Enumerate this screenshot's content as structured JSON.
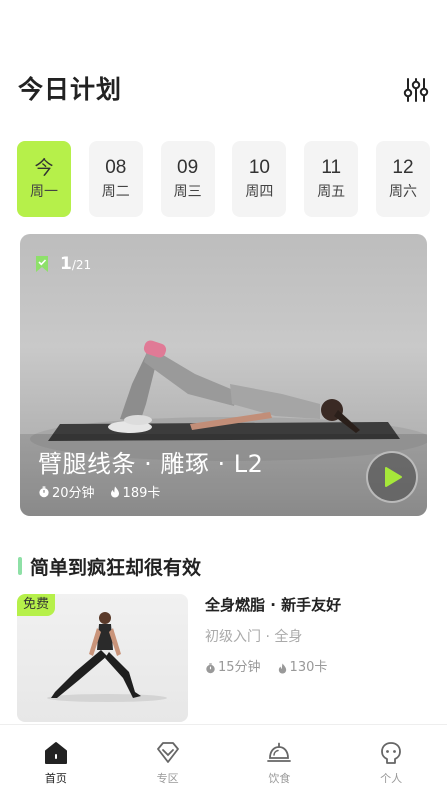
{
  "header": {
    "title": "今日计划",
    "filter_icon": "sliders-icon"
  },
  "days": [
    {
      "top": "今",
      "weekday": "周一",
      "active": true
    },
    {
      "top": "08",
      "weekday": "周二",
      "active": false
    },
    {
      "top": "09",
      "weekday": "周三",
      "active": false
    },
    {
      "top": "10",
      "weekday": "周四",
      "active": false
    },
    {
      "top": "11",
      "weekday": "周五",
      "active": false
    },
    {
      "top": "12",
      "weekday": "周六",
      "active": false
    }
  ],
  "hero": {
    "progress_current": "1",
    "progress_sep": "/",
    "progress_total": "21",
    "title": "臂腿线条 · 雕琢  · L2",
    "duration": "20分钟",
    "calories": "189卡",
    "play_icon": "play-icon",
    "bookmark_icon": "bookmark-icon"
  },
  "section": {
    "title": "简单到疯狂却很有效"
  },
  "card": {
    "badge": "免费",
    "title": "全身燃脂 · 新手友好",
    "subtitle": "初级入门 · 全身",
    "duration": "15分钟",
    "calories": "130卡"
  },
  "tabs": [
    {
      "label": "首页",
      "icon": "home-icon",
      "active": true
    },
    {
      "label": "专区",
      "icon": "diamond-icon",
      "active": false
    },
    {
      "label": "饮食",
      "icon": "cloche-icon",
      "active": false
    },
    {
      "label": "个人",
      "icon": "profile-icon",
      "active": false
    }
  ],
  "colors": {
    "accent": "#b6f04a",
    "section_bar": "#8ee0a6",
    "play_triangle": "#a6e83a"
  }
}
